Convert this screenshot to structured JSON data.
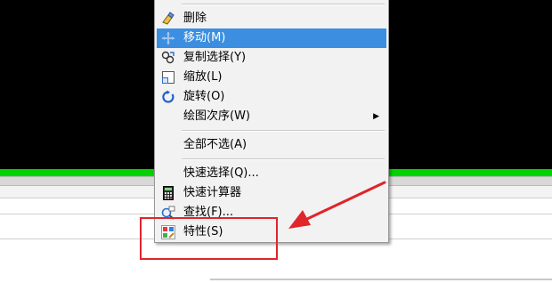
{
  "menu": {
    "items": [
      {
        "label": "删除",
        "icon": "eraser-icon"
      },
      {
        "label": "移动(M)",
        "icon": "move-icon",
        "highlighted": true
      },
      {
        "label": "复制选择(Y)",
        "icon": "copy-selection-icon"
      },
      {
        "label": "缩放(L)",
        "icon": "scale-icon"
      },
      {
        "label": "旋转(O)",
        "icon": "rotate-icon"
      },
      {
        "label": "绘图次序(W)",
        "submenu_arrow": "▶"
      },
      {
        "label": "全部不选(A)"
      },
      {
        "label": "快速选择(Q)..."
      },
      {
        "label": "快速计算器",
        "icon": "calculator-icon"
      },
      {
        "label": "查找(F)...",
        "icon": "find-icon"
      },
      {
        "label": "特性(S)",
        "icon": "properties-icon"
      }
    ]
  },
  "colors": {
    "canvas": "#000000",
    "green_bar": "#00d300",
    "highlight": "#3c8fe0",
    "annotation": "#e0252b"
  }
}
